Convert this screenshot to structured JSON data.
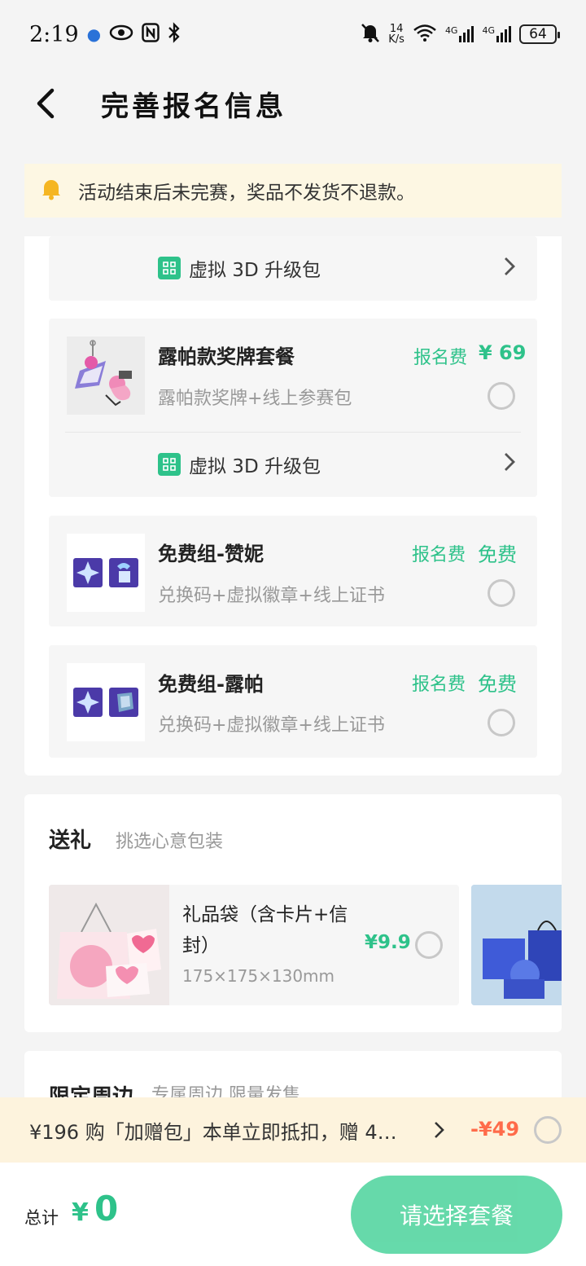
{
  "status_bar": {
    "time": "2:19",
    "net_speed": "14",
    "net_unit": "K/s",
    "signal1": "4G",
    "signal2": "4G",
    "battery": "64"
  },
  "header": {
    "title": "完善报名信息"
  },
  "notice": {
    "text": "活动结束后未完赛，奖品不发货不退款。"
  },
  "packages": {
    "upgrade_label": "虚拟 3D 升级包",
    "fee_label": "报名费",
    "items": [
      {
        "name": "露帕款奖牌套餐",
        "desc": "露帕款奖牌+线上参赛包",
        "price": "¥ 69"
      },
      {
        "name": "免费组-赞妮",
        "desc": "兑换码+虚拟徽章+线上证书",
        "price": "免费"
      },
      {
        "name": "免费组-露帕",
        "desc": "兑换码+虚拟徽章+线上证书",
        "price": "免费"
      }
    ]
  },
  "gift": {
    "title": "送礼",
    "subtitle": "挑选心意包装",
    "item": {
      "name": "礼品袋（含卡片+信封）",
      "size": "175×175×130mm",
      "price": "¥9.9"
    }
  },
  "peripheral": {
    "title": "限定周边",
    "subtitle": "专属周边 限量发售"
  },
  "promo": {
    "text": "¥196 购「加赠包」本单立即抵扣，赠 4…",
    "discount": "-¥49"
  },
  "footer": {
    "total_label": "总计",
    "currency": "¥",
    "total": "0",
    "submit_label": "请选择套餐"
  },
  "colors": {
    "accent": "#2ec28a",
    "button": "#5ed8a6",
    "discount": "#ff6b4a",
    "notice_bg": "#fdf7e3"
  }
}
